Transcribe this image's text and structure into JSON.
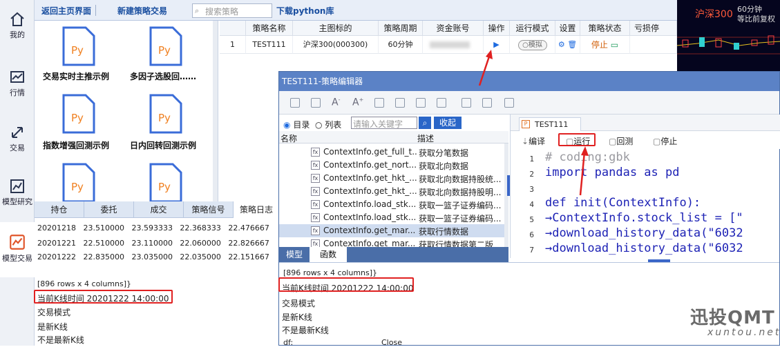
{
  "nav": {
    "items": [
      {
        "label": "我的"
      },
      {
        "label": "行情"
      },
      {
        "label": "交易"
      },
      {
        "label": "模型研究"
      },
      {
        "label": "模型交易"
      }
    ]
  },
  "topbar": {
    "back_label": "返回主页界面",
    "new_label": "新建策略交易",
    "search_placeholder": "搜索策略",
    "download_label": "下载python库"
  },
  "strategies": [
    {
      "label": "交易实时主推示例"
    },
    {
      "label": "多因子选股回……"
    },
    {
      "label": "指数增强回测示例"
    },
    {
      "label": "日内回转回测示例"
    },
    {
      "label": ""
    },
    {
      "label": ""
    }
  ],
  "table": {
    "headers": [
      "",
      "策略名称",
      "主图标的",
      "策略周期",
      "资金账号",
      "操作",
      "运行模式",
      "设置",
      "策略状态",
      "亏损停"
    ],
    "row": {
      "index": "1",
      "name": "TEST111",
      "symbol": "沪深300(000300)",
      "period": "60分钟",
      "mode": "模拟",
      "status": "停止"
    }
  },
  "chart": {
    "title": "沪深300",
    "period": "60分钟",
    "subtitle": "等比前复权"
  },
  "bottom_tabs": [
    "持仓",
    "委托",
    "成交",
    "策略信号",
    "策略日志"
  ],
  "log_rows": [
    "20201218   23.510000   23.593333   22.368333   22.476667",
    "20201221   22.510000   23.110000   22.060000   22.826667",
    "20201222   22.835000   23.035000   22.035000   22.151667"
  ],
  "log_rows_info": "[896 rows x 4 columns]}",
  "log_kline_time": "当前K线时间 20201222 14:00:00",
  "log_trade_mode": "交易模式",
  "log_is_new": "是新K线",
  "log_not_new": "不是最新K线",
  "editor": {
    "title": "TEST111-策略编辑器",
    "radio_dir": "目录",
    "radio_list": "列表",
    "search_placeholder": "请输入关键字",
    "collapse_label": "收起",
    "col_name": "名称",
    "col_desc": "描述",
    "functions": [
      {
        "name": "ContextInfo.get_full_t...",
        "desc": "获取分笔数据"
      },
      {
        "name": "ContextInfo.get_nort...",
        "desc": "获取北向数据"
      },
      {
        "name": "ContextInfo.get_hkt_...",
        "desc": "获取北向数据持股统..."
      },
      {
        "name": "ContextInfo.get_hkt_...",
        "desc": "获取北向数据持股明..."
      },
      {
        "name": "ContextInfo.load_stk...",
        "desc": "获取一篮子证券编码..."
      },
      {
        "name": "ContextInfo.load_stk...",
        "desc": "获取一篮子证券编码..."
      },
      {
        "name": "ContextInfo.get_mar...",
        "desc": "获取行情数据"
      },
      {
        "name": "ContextInfo.get_mar...",
        "desc": "获取行情数据第二版"
      }
    ],
    "tab_model": "模型",
    "tab_func": "函数",
    "file_tab": "TEST111",
    "btn_compile": "编译",
    "btn_run": "运行",
    "btn_backtest": "回测",
    "btn_stop": "停止",
    "code_lines": [
      {
        "n": "1",
        "text": "# coding:gbk"
      },
      {
        "n": "2",
        "text": "import pandas as pd"
      },
      {
        "n": "3",
        "text": ""
      },
      {
        "n": "4",
        "text": "def init(ContextInfo):"
      },
      {
        "n": "5",
        "text": "→ContextInfo.stock_list = [\""
      },
      {
        "n": "6",
        "text": "→download_history_data(\"6032"
      },
      {
        "n": "7",
        "text": "→download_history_data(\"6032"
      }
    ],
    "log_rows_info": "[896 rows x 4 columns]}",
    "log_kline_time": "当前K线时间 20201222 14:00:00",
    "log_trade_mode": "交易模式",
    "log_is_new": "是新K线",
    "log_not_new": "不是最新K线",
    "log_df": "df:",
    "log_close": "Close"
  },
  "watermark": {
    "brand": "迅投QMT",
    "url": "xuntou.net"
  },
  "colors": {
    "accent": "#1a4fa0",
    "highlight": "#e02020",
    "chart_bg": "#05051e"
  }
}
